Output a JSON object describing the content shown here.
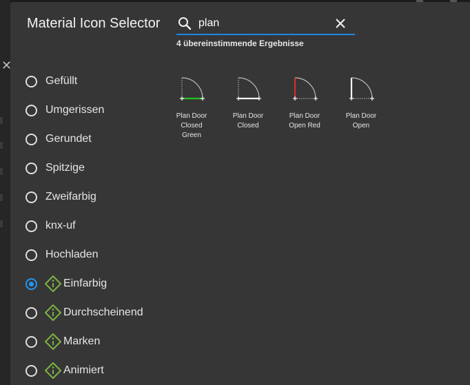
{
  "dialog": {
    "title": "Material Icon Selector",
    "search": {
      "value": "plan",
      "placeholder": ""
    },
    "result_count": "4 übereinstimmende Ergebnisse"
  },
  "styles": [
    {
      "label": "Gefüllt",
      "selected": false,
      "badge": false
    },
    {
      "label": "Umgerissen",
      "selected": false,
      "badge": false
    },
    {
      "label": "Gerundet",
      "selected": false,
      "badge": false
    },
    {
      "label": "Spitzige",
      "selected": false,
      "badge": false
    },
    {
      "label": "Zweifarbig",
      "selected": false,
      "badge": false
    },
    {
      "label": "knx-uf",
      "selected": false,
      "badge": false
    },
    {
      "label": "Hochladen",
      "selected": false,
      "badge": false
    },
    {
      "label": "Einfarbig",
      "selected": true,
      "badge": true
    },
    {
      "label": "Durchscheinend",
      "selected": false,
      "badge": true
    },
    {
      "label": "Marken",
      "selected": false,
      "badge": true
    },
    {
      "label": "Animiert",
      "selected": false,
      "badge": true
    }
  ],
  "results": [
    {
      "line1": "Plan Door",
      "line2": "Closed",
      "line3": "Green",
      "icon": "plan-door-closed-green-icon"
    },
    {
      "line1": "Plan Door",
      "line2": "Closed",
      "line3": "",
      "icon": "plan-door-closed-icon"
    },
    {
      "line1": "Plan Door",
      "line2": "Open Red",
      "line3": "",
      "icon": "plan-door-open-red-icon"
    },
    {
      "line1": "Plan Door",
      "line2": "Open",
      "line3": "",
      "icon": "plan-door-open-icon"
    }
  ],
  "colors": {
    "accent": "#2196f3",
    "search_underline": "#1e88e5",
    "badge": "#7cb342",
    "door_green": "#22c322",
    "door_red": "#d32f2f"
  }
}
